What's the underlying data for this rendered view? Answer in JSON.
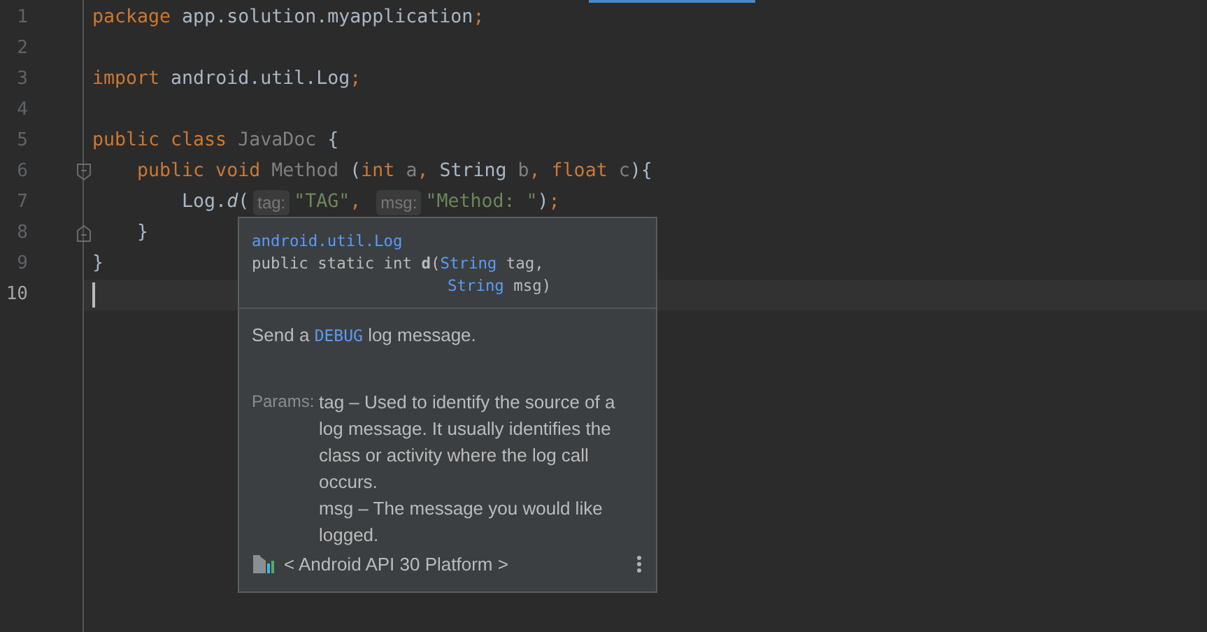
{
  "editor": {
    "lines": [
      {
        "number": "1",
        "current": false,
        "fold_start": false,
        "fold_end": false,
        "tokens": [
          {
            "text": "package ",
            "kind": "keyword"
          },
          {
            "text": "app.solution.myapplication",
            "kind": "plain"
          },
          {
            "text": ";",
            "kind": "keyword"
          }
        ]
      },
      {
        "number": "2",
        "current": false,
        "fold_start": false,
        "fold_end": false
      },
      {
        "number": "3",
        "current": false,
        "fold_start": false,
        "fold_end": false,
        "tokens": [
          {
            "text": "import ",
            "kind": "keyword"
          },
          {
            "text": "android.util.Log",
            "kind": "plain"
          },
          {
            "text": ";",
            "kind": "keyword"
          }
        ]
      },
      {
        "number": "4",
        "current": false,
        "fold_start": false,
        "fold_end": false
      },
      {
        "number": "5",
        "current": false,
        "fold_start": false,
        "fold_end": false,
        "tokens": [
          {
            "text": "public class ",
            "kind": "keyword"
          },
          {
            "text": "JavaDoc ",
            "kind": "unused"
          },
          {
            "text": "{",
            "kind": "plain"
          }
        ]
      },
      {
        "number": "6",
        "current": false,
        "fold_start": true,
        "fold_end": false,
        "tokens": [
          {
            "text": "    public void ",
            "kind": "keyword"
          },
          {
            "text": "Method ",
            "kind": "unused"
          },
          {
            "text": "(",
            "kind": "plain"
          },
          {
            "text": "int ",
            "kind": "keyword"
          },
          {
            "text": "a",
            "kind": "unused"
          },
          {
            "text": ", ",
            "kind": "keyword"
          },
          {
            "text": "String ",
            "kind": "plain"
          },
          {
            "text": "b",
            "kind": "unused"
          },
          {
            "text": ", ",
            "kind": "keyword"
          },
          {
            "text": "float ",
            "kind": "keyword"
          },
          {
            "text": "c",
            "kind": "unused"
          },
          {
            "text": "){",
            "kind": "plain"
          }
        ]
      },
      {
        "number": "7",
        "current": false,
        "fold_start": false,
        "fold_end": false,
        "tokens": [
          {
            "text": "        Log.",
            "kind": "plain"
          },
          {
            "text": "d",
            "kind": "static-call"
          },
          {
            "text": "(",
            "kind": "plain"
          },
          {
            "text": "tag:",
            "kind": "hint"
          },
          {
            "text": "\"TAG\"",
            "kind": "string"
          },
          {
            "text": ", ",
            "kind": "keyword"
          },
          {
            "text": "msg:",
            "kind": "hint"
          },
          {
            "text": "\"Method: \"",
            "kind": "string"
          },
          {
            "text": ")",
            "kind": "plain"
          },
          {
            "text": ";",
            "kind": "keyword"
          }
        ]
      },
      {
        "number": "8",
        "current": false,
        "fold_start": false,
        "fold_end": true,
        "tokens": [
          {
            "text": "    }",
            "kind": "plain"
          }
        ]
      },
      {
        "number": "9",
        "current": false,
        "fold_start": false,
        "fold_end": false,
        "tokens": [
          {
            "text": "}",
            "kind": "plain"
          }
        ]
      },
      {
        "number": "10",
        "current": true,
        "fold_start": false,
        "fold_end": false
      }
    ]
  },
  "doc_popup": {
    "package": "android.util.Log",
    "signature": [
      {
        "aligned": false,
        "tokens": [
          {
            "text": "public static int ",
            "kind": "plain"
          },
          {
            "text": "d",
            "kind": "bold"
          },
          {
            "text": "(",
            "kind": "plain"
          },
          {
            "text": "String",
            "kind": "link"
          },
          {
            "text": " tag,",
            "kind": "plain"
          }
        ]
      },
      {
        "aligned": true,
        "tokens": [
          {
            "text": "String",
            "kind": "link"
          },
          {
            "text": " msg)",
            "kind": "plain"
          }
        ]
      }
    ],
    "description": [
      {
        "text": "Send a ",
        "kind": "plain"
      },
      {
        "text": "DEBUG",
        "kind": "link"
      },
      {
        "text": " log message.",
        "kind": "plain"
      }
    ],
    "params_label": "Params:",
    "params": [
      "tag – Used to identify the source of a log message. It usually identifies the class or activity where the log call occurs.",
      "msg – The message you would like logged."
    ],
    "source": "< Android API 30 Platform >"
  }
}
